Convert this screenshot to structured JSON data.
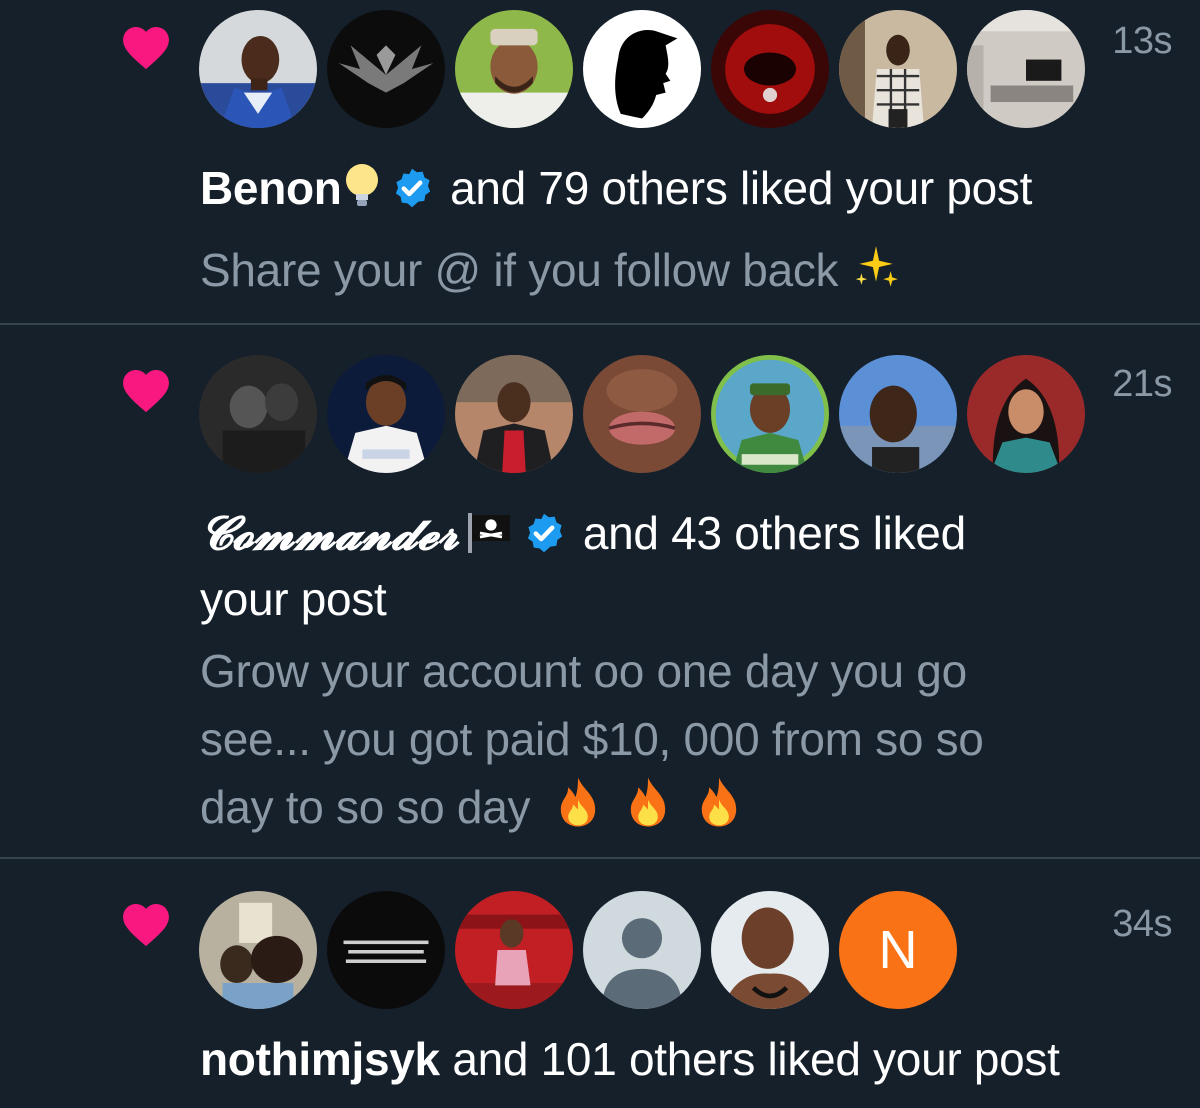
{
  "notifications": [
    {
      "time": "13s",
      "actor": "Benon",
      "action": "and 79 others liked your post",
      "post": "Share your @ if you follow back"
    },
    {
      "time": "21s",
      "actor": "𝓒𝓸𝓶𝓶𝓪𝓷𝓭𝓮𝓻",
      "action": "and 43 others liked",
      "action_wrap": "your post",
      "post_lines": [
        "Grow your account oo one day you go",
        "see... you got paid $10, 000 from so so",
        "day to so so day"
      ]
    },
    {
      "time": "34s",
      "actor": "nothimjsyk",
      "action": "and 101 others liked your post",
      "avatar_letter": "N"
    }
  ],
  "colors": {
    "background": "#15202b",
    "heart": "#f91880",
    "verified": "#1d9bf0",
    "muted_text": "#8b98a5",
    "divider": "#38444d",
    "letter_avatar": "#f97316"
  },
  "icons": [
    "heart-icon",
    "verified-badge-icon",
    "lightbulb-emoji",
    "sparkles-emoji",
    "pirate-flag-emoji",
    "fire-emoji"
  ]
}
